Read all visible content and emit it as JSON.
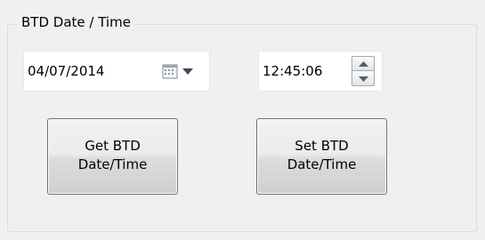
{
  "group": {
    "title": "BTD Date / Time"
  },
  "date_picker": {
    "value": "04/07/2014",
    "calendar_icon": "calendar-icon",
    "dropdown_icon": "chevron-down-icon"
  },
  "time_picker": {
    "value": "12:45:06",
    "up_icon": "spin-up-icon",
    "down_icon": "spin-down-icon"
  },
  "buttons": {
    "get_label": "Get BTD\nDate/Time",
    "set_label": "Set BTD\nDate/Time"
  },
  "colors": {
    "window_bg": "#f0f0f0",
    "group_border": "#d5dfe5",
    "input_border": "#e3e9ef",
    "button_border": "#707070"
  }
}
